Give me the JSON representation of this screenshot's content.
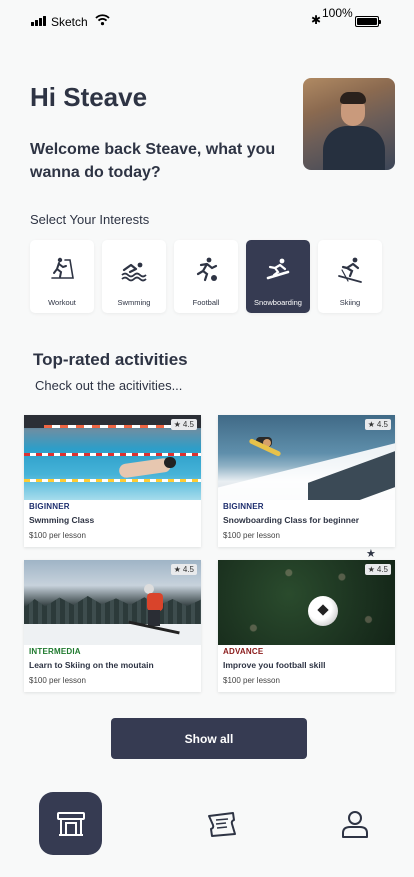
{
  "status_bar": {
    "carrier": "Sketch",
    "battery": "100%"
  },
  "header": {
    "greeting": "Hi Steave",
    "welcome": "Welcome back Steave, what you wanna do today?"
  },
  "interests": {
    "title": "Select Your Interests",
    "items": [
      {
        "label": "Workout",
        "icon": "treadmill-icon",
        "selected": false
      },
      {
        "label": "Swmming",
        "icon": "swimmer-icon",
        "selected": false
      },
      {
        "label": "Football",
        "icon": "football-player-icon",
        "selected": false
      },
      {
        "label": "Snowboarding",
        "icon": "snowboarder-icon",
        "selected": true
      },
      {
        "label": "Skiing",
        "icon": "skier-icon",
        "selected": false
      }
    ]
  },
  "activities": {
    "title": "Top-rated activities",
    "subtitle": "Check out the acitivities...",
    "cards": [
      {
        "rating": "4.5",
        "level": "BIGINNER",
        "level_color": "#1f2f6f",
        "name": "Swmming Class",
        "price": "$100 per lesson"
      },
      {
        "rating": "4.5",
        "level": "BIGINNER",
        "level_color": "#1f2f6f",
        "name": "Snowboarding Class for beginner",
        "price": "$100 per lesson"
      },
      {
        "rating": "4.5",
        "level": "INTERMEDIA",
        "level_color": "#1f7a2e",
        "name": "Learn to Skiing on the moutain",
        "price": "$100 per lesson"
      },
      {
        "rating": "4.5",
        "level": "ADVANCE",
        "level_color": "#8a1a1a",
        "name": "Improve you football skill",
        "price": "$100 per lesson"
      }
    ],
    "show_all": "Show all"
  },
  "bottom_nav": {
    "items": [
      "home-icon",
      "tickets-icon",
      "profile-icon"
    ]
  },
  "colors": {
    "primary": "#363b52",
    "background": "#f8f9f9"
  }
}
